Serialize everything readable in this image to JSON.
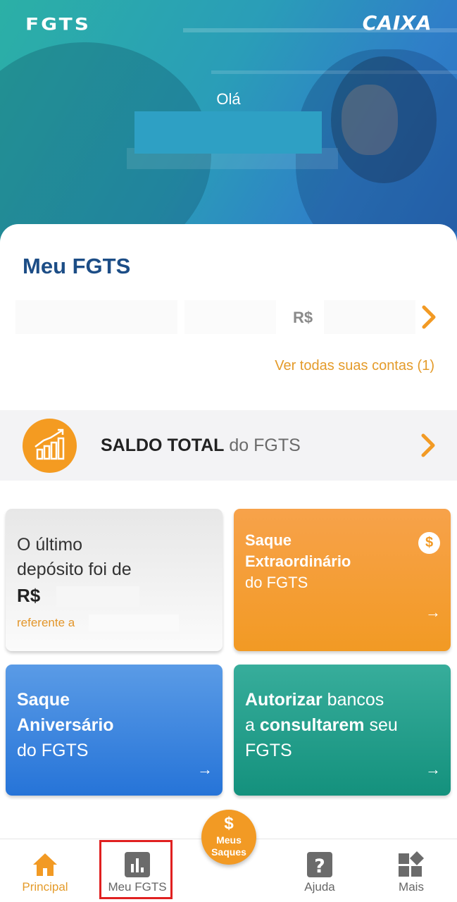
{
  "header": {
    "logo_left": "FGTS",
    "logo_right": "CAIXA",
    "greeting": "Olá"
  },
  "meu_fgts": {
    "title": "Meu FGTS",
    "account_currency": "R$",
    "see_all_link": "Ver todas suas contas (1)"
  },
  "saldo": {
    "label_bold": "SALDO TOTAL",
    "label_light": " do FGTS"
  },
  "tiles": {
    "deposit": {
      "line1": "O último",
      "line2": "depósito foi de",
      "currency": "R$",
      "reference": "referente a"
    },
    "extraordinario": {
      "line1": "Saque",
      "line2": "Extraordinário",
      "line3": "do FGTS",
      "badge": "$",
      "arrow": "→"
    },
    "aniversario": {
      "line1": "Saque",
      "line2": "Aniversário",
      "line3": "do FGTS",
      "arrow": "→"
    },
    "autorizar": {
      "bold1": "Autorizar",
      "text1": " bancos",
      "text2": "a ",
      "bold2": "consultarem",
      "text3": " seu",
      "text4": "FGTS",
      "arrow": "→"
    }
  },
  "bottom_nav": {
    "items": [
      {
        "label": "Principal",
        "icon": "home-icon",
        "active": true
      },
      {
        "label": "Meu FGTS",
        "icon": "bar-chart-icon",
        "active": false
      },
      {
        "label": "Ajuda",
        "icon": "help-icon",
        "active": false
      },
      {
        "label": "Mais",
        "icon": "more-grid-icon",
        "active": false
      }
    ],
    "fab": {
      "symbol": "$",
      "line1": "Meus",
      "line2": "Saques"
    }
  },
  "colors": {
    "accent_orange": "#f29a24",
    "title_blue": "#1c4d86",
    "tile_blue": "#2674d8",
    "tile_teal": "#14917d",
    "highlight_red": "#e02020"
  }
}
